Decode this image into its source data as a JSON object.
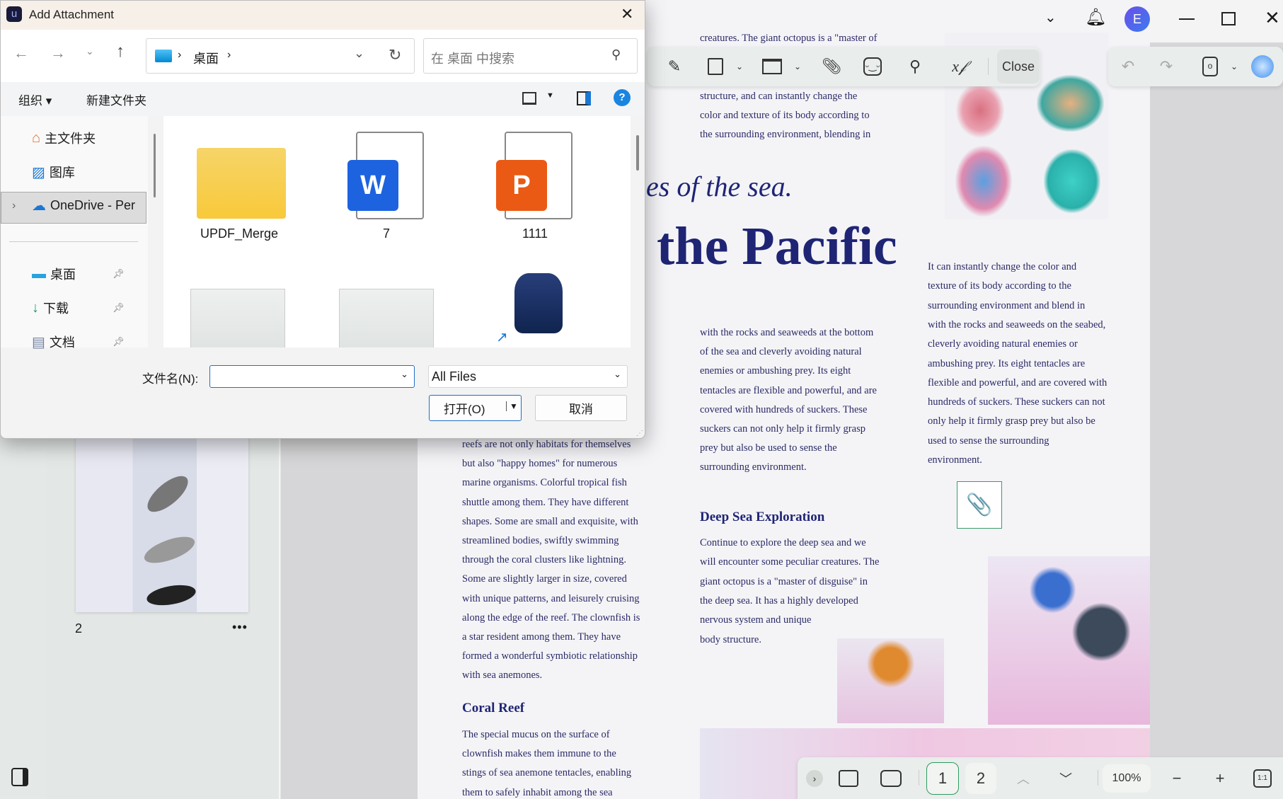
{
  "dialog": {
    "title": "Add Attachment",
    "breadcrumb": [
      "桌面"
    ],
    "search_placeholder": "在 桌面 中搜索",
    "organize": "组织",
    "new_folder": "新建文件夹",
    "nav": [
      {
        "label": "主文件夹",
        "icon": "home-icon"
      },
      {
        "label": "图库",
        "icon": "gallery-icon"
      },
      {
        "label": "OneDrive - Per",
        "icon": "cloud-icon",
        "selected": true
      },
      {
        "label": "桌面",
        "icon": "desktop-icon",
        "pinned": true
      },
      {
        "label": "下载",
        "icon": "download-icon",
        "pinned": true
      },
      {
        "label": "文档",
        "icon": "document-icon",
        "pinned": true
      }
    ],
    "files": [
      {
        "name": "UPDF_Merge",
        "type": "folder"
      },
      {
        "name": "7",
        "type": "word"
      },
      {
        "name": "1111",
        "type": "powerpoint"
      },
      {
        "name": "",
        "type": "screenshot"
      },
      {
        "name": "",
        "type": "screenshot"
      },
      {
        "name": "",
        "type": "shortcut-cat"
      }
    ],
    "filename_label": "文件名(N):",
    "filename_value": "",
    "filetype": "All Files",
    "open": "打开(O)",
    "cancel": "取消"
  },
  "app": {
    "avatar": "E",
    "close_label": "Close",
    "thumb_page": "2",
    "page_buttons": [
      "1",
      "2"
    ],
    "current_page": "1",
    "zoom": "100%",
    "actual_size": "1:1",
    "accent": "#2e9b5f"
  },
  "doc": {
    "top_partial": "creatures. The giant octopus is a \"master of",
    "top_lines": [
      "structure, and can instantly change the",
      "color and texture of its body according to",
      "the surrounding environment, blending in"
    ],
    "italic_title": "es of the sea.",
    "big_title": "the Pacific",
    "col3": [
      "It can instantly change the color and",
      "texture of its body according to the",
      "surrounding environment and blend in",
      "with the rocks and seaweeds on the seabed,",
      "cleverly avoiding natural enemies or",
      "ambushing prey. Its eight tentacles are",
      "flexible and powerful, and are covered with",
      "hundreds of suckers. These suckers can not",
      "only help it firmly grasp prey but also be",
      "used to sense the surrounding",
      "environment."
    ],
    "col2": [
      "with the rocks and seaweeds at the bottom",
      "of the sea and cleverly avoiding natural",
      "enemies or ambushing prey. Its eight",
      "tentacles are flexible and powerful, and are",
      "covered with hundreds of suckers. These",
      "suckers can not only help it firmly grasp",
      "prey but also be used to sense the",
      "surrounding environment."
    ],
    "deep_heading": "Deep Sea Exploration",
    "deep_lines": [
      "Continue to explore the deep sea and we",
      "will encounter some peculiar creatures. The",
      "giant octopus is a \"master of disguise\" in",
      "the deep sea. It has a highly developed",
      "nervous system and unique",
      "body structure."
    ],
    "col1": [
      "reefs are not only habitats for themselves",
      "but also \"happy homes\" for numerous",
      "marine organisms. Colorful tropical fish",
      "shuttle among them. They have different",
      "shapes. Some are small and exquisite, with",
      "streamlined bodies, swiftly swimming",
      "through the coral clusters like lightning.",
      "Some are slightly larger in size, covered",
      "with unique patterns, and leisurely cruising",
      "along the edge of the reef. The clownfish is",
      "a star resident among them. They have",
      "formed a wonderful symbiotic relationship",
      "with sea anemones."
    ],
    "coral_heading": "Coral Reef",
    "coral_lines": [
      " The special mucus on the surface of",
      "clownfish makes them immune to the",
      "stings of sea anemone tentacles, enabling",
      "them to safely inhabit among the sea"
    ]
  }
}
